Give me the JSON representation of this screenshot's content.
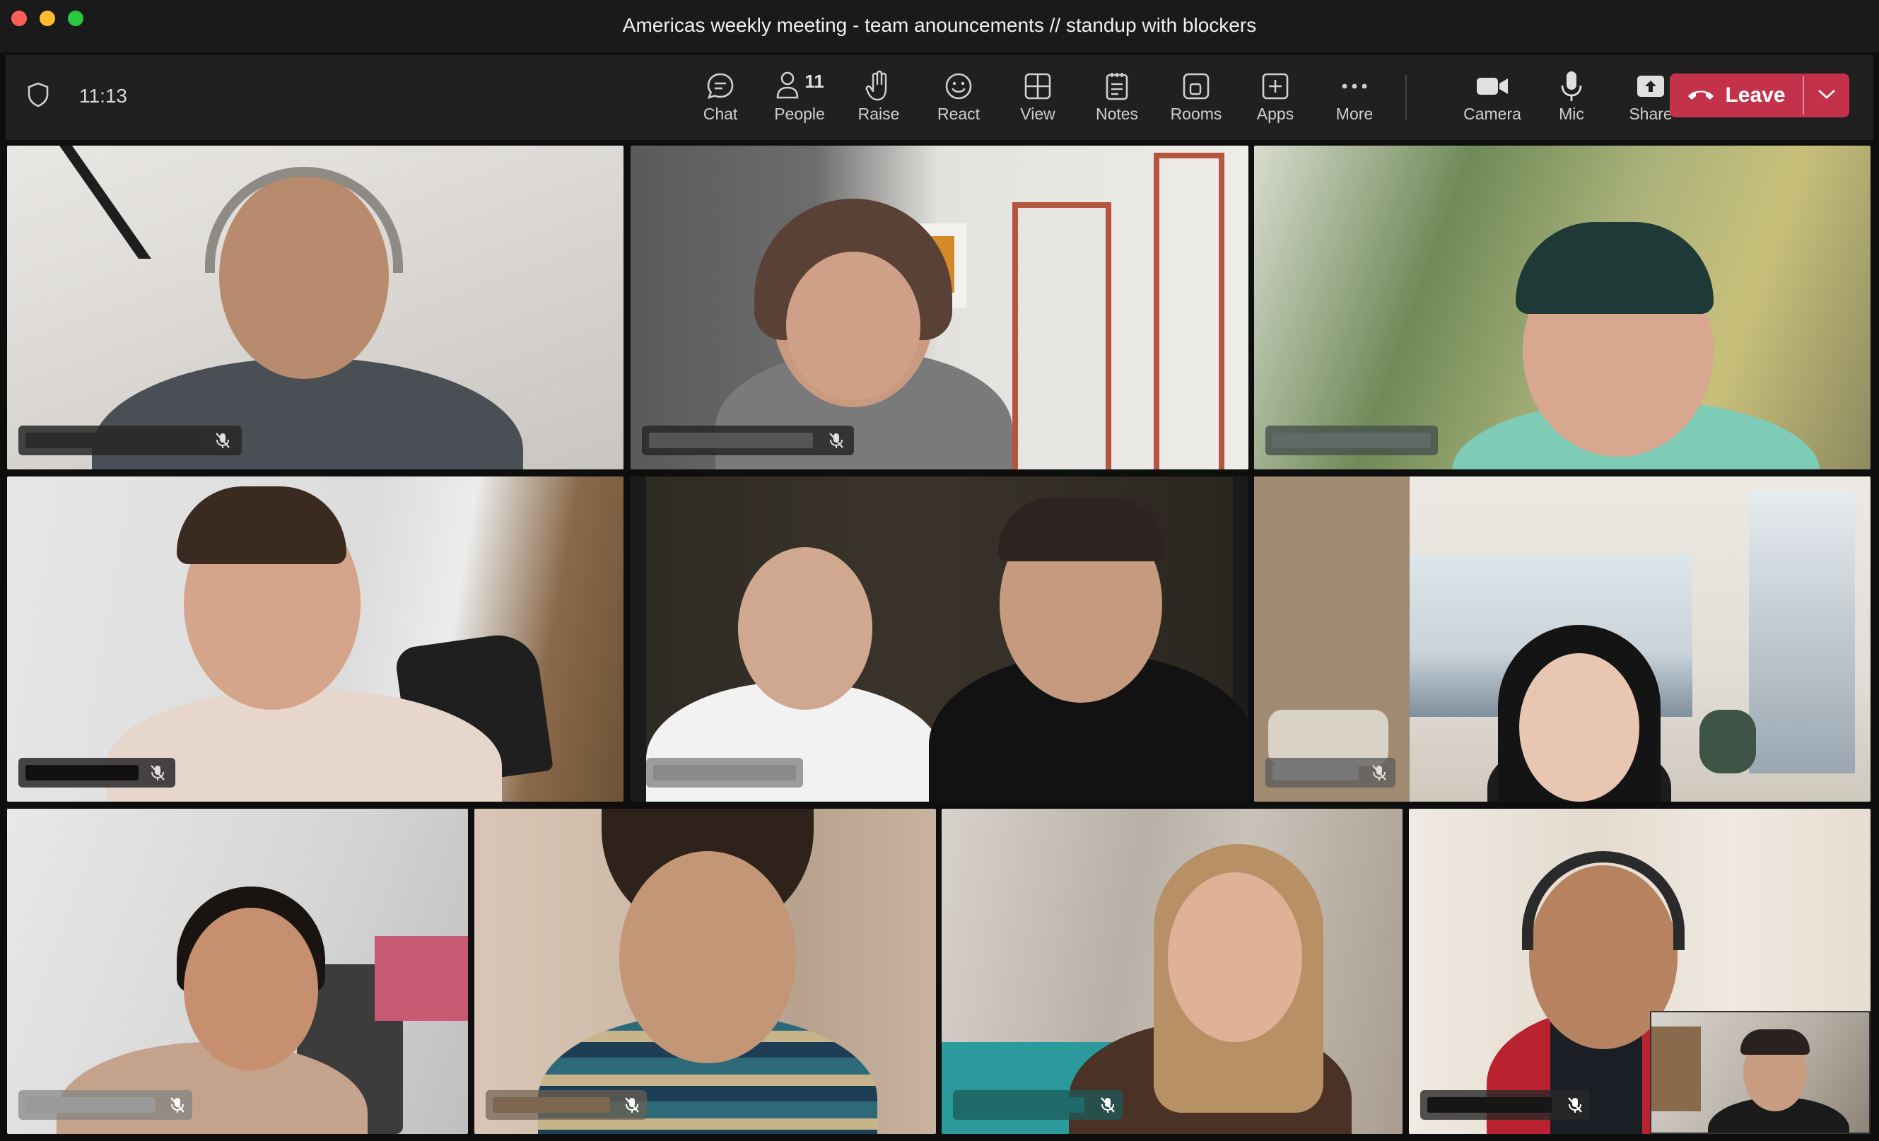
{
  "window": {
    "title": "Americas weekly meeting - team anouncements // standup with blockers"
  },
  "toolbar": {
    "time": "11:13",
    "people_count": "11",
    "buttons": {
      "chat": "Chat",
      "people": "People",
      "raise": "Raise",
      "react": "React",
      "view": "View",
      "notes": "Notes",
      "rooms": "Rooms",
      "apps": "Apps",
      "more": "More",
      "camera": "Camera",
      "mic": "Mic",
      "share": "Share"
    },
    "leave_label": "Leave",
    "leave_color": "#c4314b"
  },
  "participants": [
    {
      "tile": 1,
      "muted": true
    },
    {
      "tile": 2,
      "muted": true
    },
    {
      "tile": 3,
      "muted": false
    },
    {
      "tile": 4,
      "muted": true
    },
    {
      "tile": 5,
      "muted": false
    },
    {
      "tile": 6,
      "muted": true
    },
    {
      "tile": 7,
      "muted": true
    },
    {
      "tile": 8,
      "muted": true
    },
    {
      "tile": 9,
      "muted": true
    },
    {
      "tile": 10,
      "muted": true
    },
    {
      "tile": "self-view",
      "muted": false
    }
  ]
}
